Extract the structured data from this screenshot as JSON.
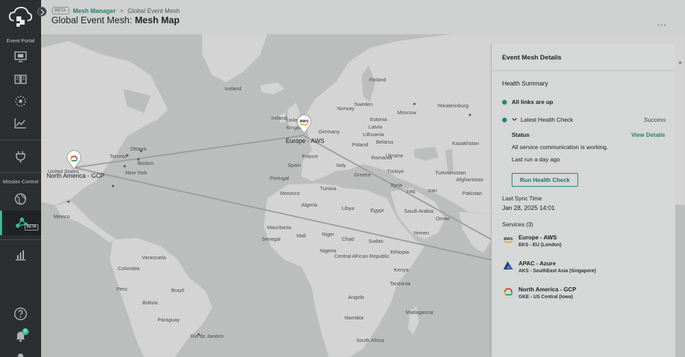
{
  "sidebar": {
    "section_event_portal": "Event Portal",
    "section_mission_control": "Mission Control",
    "beta_badge": "BETA",
    "notification_count": "6"
  },
  "header": {
    "beta_tag": "BETA",
    "breadcrumb_link": "Mesh Manager",
    "breadcrumb_separator": ">",
    "breadcrumb_current": "Global Event Mesh",
    "title_prefix": "Global Event Mesh:",
    "title_main": "Mesh Map",
    "more_icon": "⋯"
  },
  "map": {
    "regions": {
      "europe": "Europe - AWS",
      "north_america": "North America - GCP"
    },
    "labels": {
      "iceland": "Iceland",
      "norway": "Norway",
      "sweden": "Sweden",
      "finland": "Finland",
      "estonia": "Estonia",
      "latvia": "Latvia",
      "lithuania": "Lithuania",
      "belarus": "Belarus",
      "ukraine": "Ukraine",
      "poland": "Poland",
      "germany": "Germany",
      "france": "France",
      "spain": "Spain",
      "portugal": "Portugal",
      "italy": "Italy",
      "greece": "Greece",
      "romania": "Romania",
      "turkiye": "Türkiye",
      "kazakhstan": "Kazakhstan",
      "turkmenistan": "Turkmenistan",
      "syria": "Syria",
      "iraq": "Iraq",
      "iran": "Iran",
      "afghanistan": "Afghanistan",
      "pakistan": "Pakistan",
      "saudi_arabia": "Saudi Arabia",
      "yemen": "Yemen",
      "oman": "Oman",
      "egypt": "Egypt",
      "libya": "Libya",
      "algeria": "Algeria",
      "tunisia": "Tunisia",
      "morocco": "Morocco",
      "mauritania": "Mauritania",
      "mali": "Mali",
      "niger": "Niger",
      "chad": "Chad",
      "sudan": "Sudan",
      "ethiopia": "Ethiopia",
      "nigeria": "Nigeria",
      "senegal": "Senegal",
      "central_african_rep": "Central African Republic",
      "kenya": "Kenya",
      "tanzania": "Tanzania",
      "angola": "Angola",
      "madagascar": "Madagascar",
      "namibia": "Namibia",
      "south_africa": "South Africa",
      "colombia": "Colombia",
      "venezuela": "Venezuela",
      "peru": "Peru",
      "brazil": "Brazil",
      "bolivia": "Bolivia",
      "paraguay": "Paraguay",
      "rio": "Rio de Janeiro",
      "mexico": "Mexico",
      "united_states": "United States",
      "new_york": "New York",
      "toronto": "Toronto",
      "ottawa": "Ottawa",
      "boston": "Boston",
      "ireland": "Ireland",
      "kingdom": "Kingdom",
      "united": "United",
      "moscow": "Moscow",
      "yekaterinburg": "Yekaterinburg"
    }
  },
  "panel": {
    "title": "Event Mesh Details",
    "expand_icon": "»",
    "health_summary": "Health Summary",
    "all_links": "All links are up",
    "latest_check": "Latest Health Check",
    "latest_status": "Success",
    "status_label": "Status",
    "view_details": "View Details",
    "status_message": "All service communication is working.",
    "last_run": "Last run a day ago",
    "run_button": "Run Health Check",
    "last_sync_label": "Last Sync Time",
    "last_sync_value": "Jan 28, 2025 14:01",
    "services_label": "Services (3)",
    "services": [
      {
        "name": "Europe - AWS",
        "meta": "EKS - EU (London)",
        "logo": "aws-logo"
      },
      {
        "name": "APAC - Azure",
        "meta": "AKS - SouthEast Asia (Singapore)",
        "logo": "azure-logo"
      },
      {
        "name": "North America - GCP",
        "meta": "GKE - US Central (Iowa)",
        "logo": "gcp-logo"
      }
    ]
  },
  "colors": {
    "accent": "#1f7f6b",
    "sidebar_bg": "#2b2f31",
    "map_water": "#bcbdbd",
    "map_land": "#d4d4d4"
  }
}
